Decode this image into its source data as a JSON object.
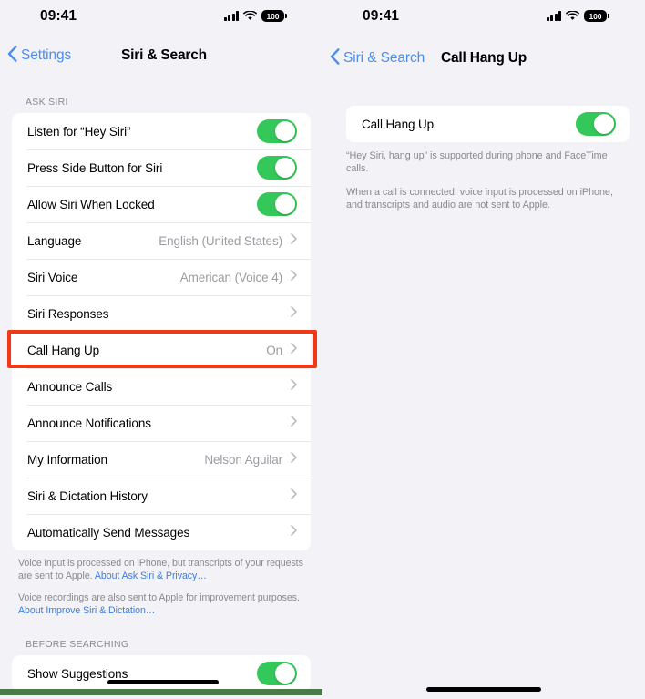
{
  "status_bar": {
    "time": "09:41",
    "battery_level": "100",
    "icons": [
      "cellular-signal-icon",
      "wifi-icon",
      "battery-icon"
    ]
  },
  "left_screen": {
    "nav": {
      "back_label": "Settings",
      "title": "Siri & Search"
    },
    "sections": [
      {
        "header": "ASK SIRI",
        "rows": [
          {
            "label": "Listen for “Hey Siri”",
            "type": "toggle",
            "value": "On"
          },
          {
            "label": "Press Side Button for Siri",
            "type": "toggle",
            "value": "On"
          },
          {
            "label": "Allow Siri When Locked",
            "type": "toggle",
            "value": "On"
          },
          {
            "label": "Language",
            "type": "disclosure",
            "value": "English (United States)"
          },
          {
            "label": "Siri Voice",
            "type": "disclosure",
            "value": "American (Voice 4)"
          },
          {
            "label": "Siri Responses",
            "type": "disclosure",
            "value": ""
          },
          {
            "label": "Call Hang Up",
            "type": "disclosure",
            "value": "On",
            "highlighted": true
          },
          {
            "label": "Announce Calls",
            "type": "disclosure",
            "value": ""
          },
          {
            "label": "Announce Notifications",
            "type": "disclosure",
            "value": ""
          },
          {
            "label": "My Information",
            "type": "disclosure",
            "value": "Nelson Aguilar"
          },
          {
            "label": "Siri & Dictation History",
            "type": "disclosure",
            "value": ""
          },
          {
            "label": "Automatically Send Messages",
            "type": "disclosure",
            "value": ""
          }
        ]
      }
    ],
    "footnotes": [
      {
        "text": "Voice input is processed on iPhone, but transcripts of your requests are sent to Apple. ",
        "link": "About Ask Siri & Privacy…"
      },
      {
        "text": "Voice recordings are also sent to Apple for improvement purposes. ",
        "link": "About Improve Siri & Dictation…"
      }
    ],
    "section_two": {
      "header": "BEFORE SEARCHING",
      "rows": [
        {
          "label": "Show Suggestions",
          "type": "toggle",
          "value": "On"
        }
      ]
    }
  },
  "right_screen": {
    "nav": {
      "back_label": "Siri & Search",
      "title": "Call Hang Up"
    },
    "rows": [
      {
        "label": "Call Hang Up",
        "type": "toggle",
        "value": "On"
      }
    ],
    "notes": [
      "“Hey Siri, hang up” is supported during phone and FaceTime calls.",
      "When a call is connected, voice input is processed on iPhone, and transcripts and audio are not sent to Apple."
    ]
  },
  "colors": {
    "accent_blue": "#4a8ef0",
    "link_blue": "#3f7ddb",
    "toggle_green": "#34c759",
    "highlight_red": "#f03a17",
    "background": "#f2f2f7",
    "card": "#ffffff",
    "secondary_text": "#8a8a8e"
  },
  "annotation": {
    "highlight_target": "Call Hang Up"
  }
}
